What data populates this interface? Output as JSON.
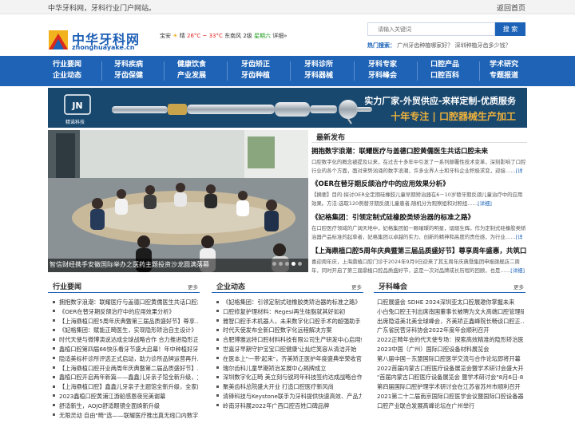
{
  "topbar": {
    "welcome": "中华牙科网，牙科行业门户网站。",
    "home_link": "返回首页"
  },
  "logo": {
    "cn": "中华牙科网",
    "en": "zhonghuayake.cn"
  },
  "weather": {
    "city": "宝安",
    "condition": "晴",
    "temp": "26°C ~ 33°C",
    "wind": "东南风 2级",
    "aqi": "星期六",
    "detail": "详细»"
  },
  "search": {
    "placeholder": "请输入关键词",
    "button": "搜 索"
  },
  "hot_search": {
    "label": "热门搜索：",
    "text": "广州牙齿种植哪家好？ 深圳种植牙齿多少钱？"
  },
  "nav": [
    {
      "top": "行业要闻",
      "bottom": "企业动态"
    },
    {
      "top": "牙科疾病",
      "bottom": "牙齿保健"
    },
    {
      "top": "健康饮食",
      "bottom": "产业发展"
    },
    {
      "top": "牙齿矫正",
      "bottom": "牙齿种植"
    },
    {
      "top": "牙科诊所",
      "bottom": "牙科器械"
    },
    {
      "top": "牙科专家",
      "bottom": "牙科峰会"
    },
    {
      "top": "口腔产品",
      "bottom": "口腔百科"
    },
    {
      "top": "学术研究",
      "bottom": "专题报道"
    }
  ],
  "banner": {
    "brand": "精诺科技",
    "line1": "实力厂家-外贸供应-来样定制-优质服务",
    "line2": "十年专注 | 口腔器械生产加工"
  },
  "slider": {
    "caption": "智信财经携手安徽国际举办之医药主题投资沙龙圆满落幕"
  },
  "latest": {
    "title": "最新发布",
    "items": [
      {
        "title": "拥抱数字浪潮：联耀医疗与盖德口腔黄儒医生共话口腔未来",
        "desc": "口腔数字化的概念被提及以来，在过去十多年中引发了一系列颠覆性技术变革，深刻影响了口腔行业的各个方面，面对来势汹涌的数字浪潮，许多业界人士和牙科企业积极求变，迎接……",
        "more": "[详细]"
      },
      {
        "title": "《OER在替牙期反颌治疗中的应用效果分析》",
        "desc": "【摘要】目的:探讨OER全定期硅橡胶儿童早期矫治器在6－10岁替牙期反颌儿童治疗中的应用效果。方法:选取120例替牙期反颌儿童患者,随机分为观察组和对照组……",
        "more": "[详细]"
      },
      {
        "title": "《妃格集团：引领定制式硅橡胶类矫治器的标准之路》",
        "desc": "在口腔医疗领域的广阔天地中，妃格集团如一颗璀璨的明星，熠熠生辉。作为定制式硅橡胶类矫治器产品标准的起草者，妃格集团以卓越的实力、创新的精神和高度的责任感，为行业……",
        "more": "[详细]"
      },
      {
        "title": "【上海鼎植口腔5周年庆典暨第三届品质盛好节】尊享周年盛惠，共筑口",
        "desc": "喜迎周年庆，上海鼎植口腔门诊于2024年9月9日迎来了其五周年庆典暨集团申报旗舰店二周年，同时开启了第三届鼎植口腔品质盛好节，这是一次对品牌成长历程的回顾，也是……",
        "more": "[详细]"
      }
    ]
  },
  "boxes": [
    {
      "title": "行业要闻",
      "more": "更多",
      "items": [
        "拥抱数字浪潮：联耀医疗与盖德口腔黄儒医生共话口腔未",
        "《OER在替牙期反颌治疗中的应用效果分析》",
        "【上海鼎植口腔5周年庆典暨第三届品质盛好节】尊享…",
        "《妃格集团：赋能正畸医生，实现隐形矫治自主设计》",
        "时代天使与微博演说达成全球战略合作 合力推进隐形正畸…",
        "鑫植口腔第四届66快乐看牙节盛大启幕！年中种植好牙…",
        "隐适美标杆诊所评选正式启动，助力诊所品牌运营再升…",
        "【上海鼎植口腔开业两周年庆典暨第二届品质盛好节】…",
        "鑫植口腔开启两年新篇——鑫鑫儿牙亲子馆全新升级，为…",
        "【上海鼎植口腔】鑫鑫儿牙亲子主题馆全新升级，全家口…",
        "2023鑫植口腔黄浦江游船感恩夜完美谢幕",
        "舒适新生，AOJO舒适眼镜全面焕新升级",
        "无限灵动 自由\"畸\"选——联耀医疗推出真无线口内数字…"
      ]
    },
    {
      "title": "企业动态",
      "more": "更多",
      "items": [
        "《妃格集团：引领定制式硅橡胶类矫治器的标准之路》",
        "口腔修复护理材料：Regesi再生硅脂就其好如初",
        "雅智口腔手术机器人，未来数字化口腔手术的超强助手",
        "时代天使发布全新口腔数字化远程解决方案",
        "合肥博雅远特口腔材料科技有限公司生产研发中心启用仪式…",
        "世嘉牙早期守护宝宝口腔健康'让灿烂笑容从清洁开始",
        "在医本上\"一带'起来\"，齐美矫正医护年度盛典举荣收官",
        "瑞尔齿科儿童早期矫治发展中心揭牌成立",
        "深圳数字化正畸 美立刻与锐珂年科技签约达成战略合作",
        "聚美齿科总院盛大开业 打造口腔医疗新风尚",
        "清锋科技与Keystone联手为牙科提供快速高效、产品力…",
        "岭南牙科展2022年广西口腔百姓口碑品牌"
      ]
    },
    {
      "title": "牙科峰会",
      "more": "更多",
      "items": [
        "口腔展盛会 SDHE 2024深圳亚太口腔展邀你掌握未来",
        "小白兔口腔王刊出席南国董事长被聘为文大高端口腔管理研修班…",
        "出席隐适美北美全球峰会，齐美矫正鑫峰院长畅谈口腔正…",
        "广东省民营牙科协会2022年度年会顺利召开",
        "2022正畸年会的代天使专场：探索高效精准的隐形矫治医…",
        "2023中国（广州）国际口腔设备材料展览会",
        "第八届中国－东盟国际口腔医学交流与合作论坛即将开幕",
        "2022首届内蒙古口腔医疗设备展览会暨学术研讨会盛大开幕",
        "\"首届内蒙古口腔医疗设备展览会 暨学术研讨会\"8月6日-8…",
        "第四届国际口腔护理学术研讨会在江苏省苏州市顺利召开",
        "2021第二十二届南京国际口腔医学会议暨国际口腔设备器材展…",
        "口腔产业联合发展高峰论坛在广州举行"
      ]
    }
  ],
  "colors": {
    "brand": "#1e63b6",
    "banner_bg": "#19486f",
    "banner_accent": "#f0b23a"
  }
}
